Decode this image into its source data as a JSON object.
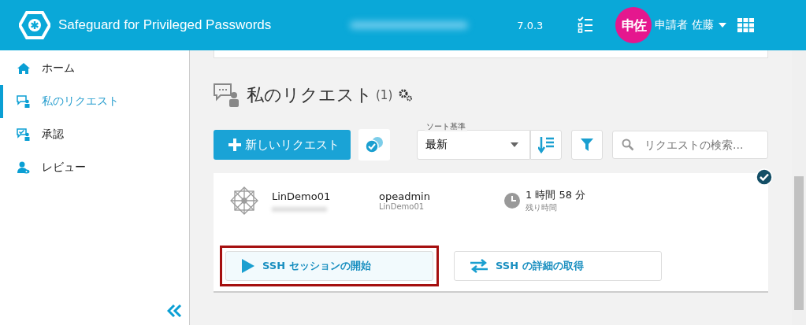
{
  "header": {
    "title": "Safeguard for Privileged Passwords",
    "version": "7.0.3",
    "avatar": "申佐",
    "user": "申請者 佐藤"
  },
  "sidebar": {
    "items": [
      {
        "label": "ホーム",
        "kind": "home",
        "selected": false
      },
      {
        "label": "私のリクエスト",
        "kind": "request",
        "selected": true
      },
      {
        "label": "承認",
        "kind": "approve",
        "selected": false
      },
      {
        "label": "レビュー",
        "kind": "review",
        "selected": false
      }
    ]
  },
  "page": {
    "title": "私のリクエスト",
    "count": "(1)"
  },
  "toolbar": {
    "new_button": "新しいリクエスト",
    "sort_label": "ソート基準",
    "sort_value": "最新",
    "search_placeholder": "リクエストの検索..."
  },
  "requests": [
    {
      "asset": "LinDemo01",
      "account": "opeadmin",
      "account_asset": "LinDemo01",
      "time": "1 時間 58 分",
      "time_label": "残り時間",
      "checked": true,
      "actions": [
        {
          "label": "SSH セッションの開始",
          "kind": "play",
          "highlighted": true
        },
        {
          "label": "SSH の詳細の取得",
          "kind": "swap",
          "highlighted": false
        }
      ]
    }
  ]
}
